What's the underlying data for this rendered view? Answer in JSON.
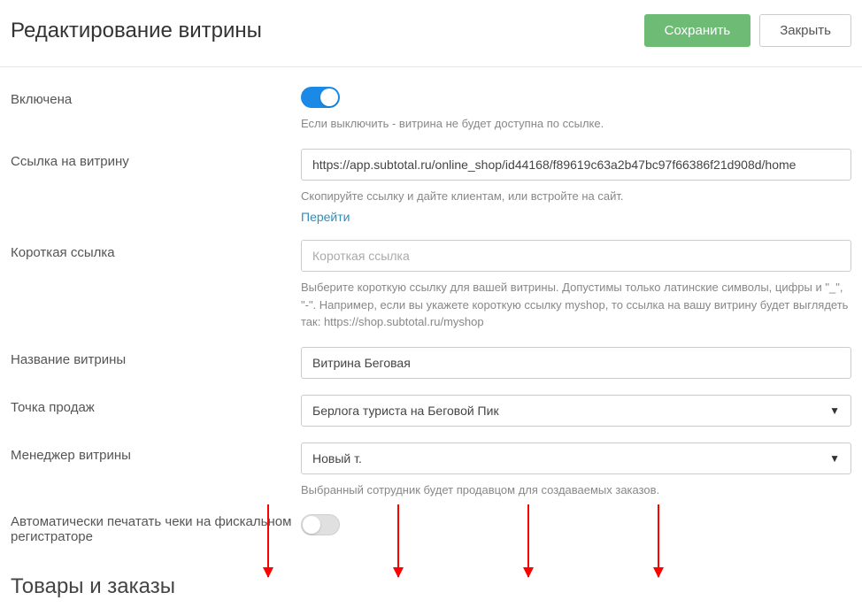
{
  "header": {
    "title": "Редактирование витрины",
    "save_label": "Сохранить",
    "close_label": "Закрыть"
  },
  "fields": {
    "enabled": {
      "label": "Включена",
      "help": "Если выключить - витрина не будет доступна по ссылке."
    },
    "link": {
      "label": "Ссылка на витрину",
      "value": "https://app.subtotal.ru/online_shop/id44168/f89619c63a2b47bc97f66386f21d908d/home",
      "help": "Скопируйте ссылку и дайте клиентам, или встройте на сайт.",
      "goto": "Перейти"
    },
    "short_link": {
      "label": "Короткая ссылка",
      "placeholder": "Короткая ссылка",
      "help": "Выберите короткую ссылку для вашей витрины. Допустимы только латинские символы, цифры и \"_\", \"-\". Например, если вы укажете короткую ссылку myshop, то ссылка на вашу витрину будет выглядеть так: https://shop.subtotal.ru/myshop"
    },
    "name": {
      "label": "Название витрины",
      "value": "Витрина Беговая"
    },
    "pos": {
      "label": "Точка продаж",
      "value": "Берлога туриста на Беговой Пик"
    },
    "manager": {
      "label": "Менеджер витрины",
      "value": "Новый т.",
      "help": "Выбранный сотрудник будет продавцом для создаваемых заказов."
    },
    "auto_print": {
      "label": "Автоматически печатать чеки на фискальном регистраторе"
    }
  },
  "section_goods": "Товары и заказы"
}
